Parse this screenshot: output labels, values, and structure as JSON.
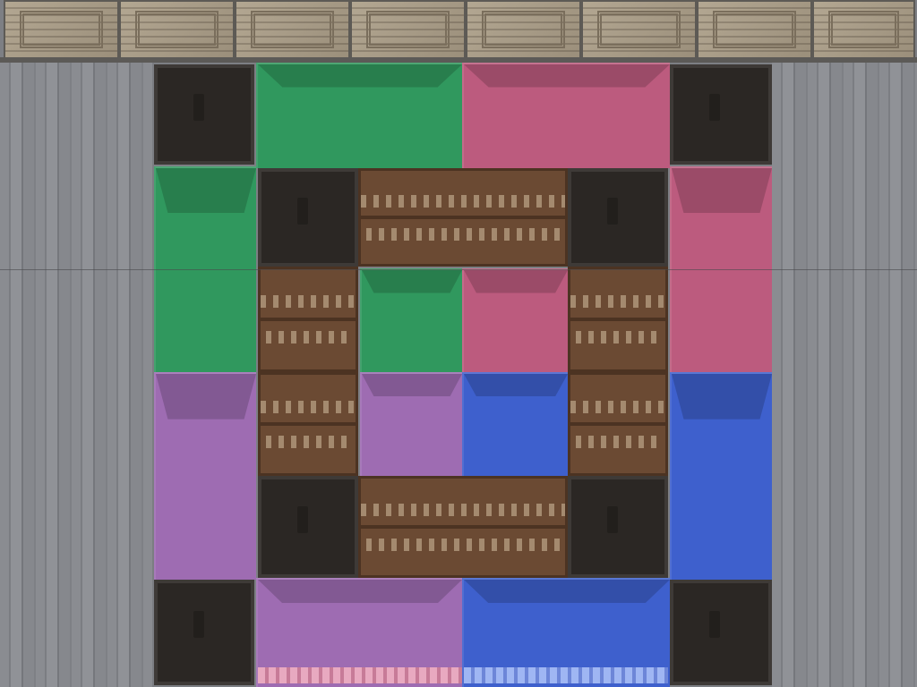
{
  "colors": {
    "green": "#2c9a5c",
    "pink": "#c05a7e",
    "purple": "#a06bb5",
    "blue": "#3b5fd1",
    "dark": "#2b2724",
    "shelf": "#6b4a33",
    "wall": "#8a8c91",
    "ceiling": "#a89c87"
  },
  "blocks": [
    {
      "name": "dark-block-top-left",
      "type": "dark"
    },
    {
      "name": "green-glass-top",
      "type": "green"
    },
    {
      "name": "pink-glass-top",
      "type": "pink"
    },
    {
      "name": "dark-block-top-right",
      "type": "dark"
    },
    {
      "name": "green-glass-left-upper",
      "type": "green"
    },
    {
      "name": "dark-block-inner-top-left",
      "type": "dark"
    },
    {
      "name": "bookshelf-top",
      "type": "shelf"
    },
    {
      "name": "dark-block-inner-top-right",
      "type": "dark"
    },
    {
      "name": "pink-glass-right-upper",
      "type": "pink"
    },
    {
      "name": "bookshelf-left-upper",
      "type": "shelf"
    },
    {
      "name": "green-glass-center",
      "type": "green"
    },
    {
      "name": "pink-glass-center",
      "type": "pink"
    },
    {
      "name": "bookshelf-right-upper",
      "type": "shelf"
    },
    {
      "name": "purple-glass-left-lower",
      "type": "purple"
    },
    {
      "name": "bookshelf-left-lower",
      "type": "shelf"
    },
    {
      "name": "purple-glass-center",
      "type": "purple"
    },
    {
      "name": "blue-glass-center",
      "type": "blue"
    },
    {
      "name": "bookshelf-right-lower",
      "type": "shelf"
    },
    {
      "name": "blue-glass-right-lower",
      "type": "blue"
    },
    {
      "name": "dark-block-inner-bottom-left",
      "type": "dark"
    },
    {
      "name": "bookshelf-bottom",
      "type": "shelf"
    },
    {
      "name": "dark-block-inner-bottom-right",
      "type": "dark"
    },
    {
      "name": "dark-block-bottom-left",
      "type": "dark"
    },
    {
      "name": "purple-glass-bottom",
      "type": "purple"
    },
    {
      "name": "blue-glass-bottom",
      "type": "blue"
    },
    {
      "name": "dark-block-bottom-right",
      "type": "dark"
    }
  ]
}
